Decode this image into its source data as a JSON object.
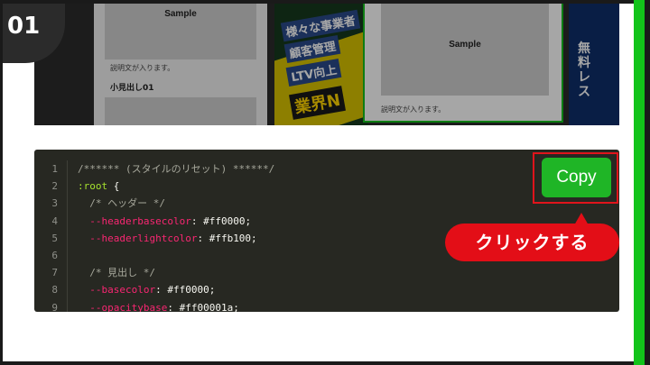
{
  "step": {
    "number": "01"
  },
  "preview": {
    "card_left": {
      "image_label": "Sample",
      "description": "説明文が入ります。",
      "subheading": "小見出し01"
    },
    "banner": {
      "lines": [
        "様々な事業者",
        "顧客管理",
        "LTV向上",
        "業界N"
      ]
    },
    "card_right": {
      "image_label": "Sample",
      "description": "説明文が入ります。"
    },
    "banner_right": {
      "text": "無料レス"
    }
  },
  "code": {
    "line_numbers": [
      "1",
      "2",
      "3",
      "4",
      "5",
      "6",
      "7",
      "8",
      "9"
    ],
    "lines": [
      [
        {
          "t": "/****** (スタイルのリセット) ******/",
          "c": "comment"
        }
      ],
      [
        {
          "t": ":root",
          "c": "sel"
        },
        {
          "t": " {",
          "c": "val"
        }
      ],
      [
        {
          "t": "  /* ヘッダー */",
          "c": "comment"
        }
      ],
      [
        {
          "t": "  --headerbasecolor",
          "c": "prop"
        },
        {
          "t": ": #ff0000;",
          "c": "val"
        }
      ],
      [
        {
          "t": "  --headerlightcolor",
          "c": "prop"
        },
        {
          "t": ": #ffb100;",
          "c": "val"
        }
      ],
      [
        {
          "t": "",
          "c": "val"
        }
      ],
      [
        {
          "t": "  /* 見出し */",
          "c": "comment"
        }
      ],
      [
        {
          "t": "  --basecolor",
          "c": "prop"
        },
        {
          "t": ": #ff0000;",
          "c": "val"
        }
      ],
      [
        {
          "t": "  --opacitybase",
          "c": "prop"
        },
        {
          "t": ": #ff00001a;",
          "c": "val"
        }
      ]
    ]
  },
  "copy_button": {
    "label": "Copy"
  },
  "callout": {
    "text": "クリックする"
  },
  "colors": {
    "accent_green": "#12c31a",
    "callout_red": "#e30e17",
    "copy_green": "#1fb526",
    "code_bg": "#272822"
  }
}
